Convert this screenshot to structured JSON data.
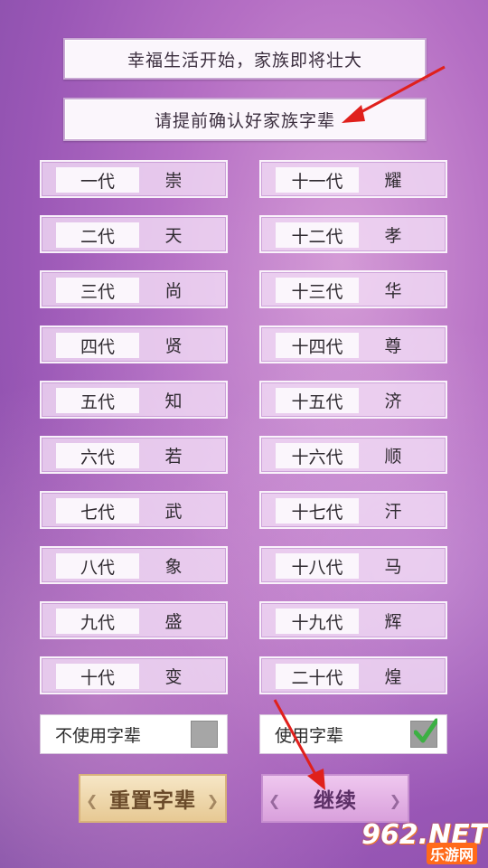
{
  "banner_top": "幸福生活开始，家族即将壮大",
  "banner_confirm": "请提前确认好家族字辈",
  "generations": [
    {
      "label": "一代",
      "char": "崇"
    },
    {
      "label": "二代",
      "char": "天"
    },
    {
      "label": "三代",
      "char": "尚"
    },
    {
      "label": "四代",
      "char": "贤"
    },
    {
      "label": "五代",
      "char": "知"
    },
    {
      "label": "六代",
      "char": "若"
    },
    {
      "label": "七代",
      "char": "武"
    },
    {
      "label": "八代",
      "char": "象"
    },
    {
      "label": "九代",
      "char": "盛"
    },
    {
      "label": "十代",
      "char": "变"
    },
    {
      "label": "十一代",
      "char": "耀"
    },
    {
      "label": "十二代",
      "char": "孝"
    },
    {
      "label": "十三代",
      "char": "华"
    },
    {
      "label": "十四代",
      "char": "尊"
    },
    {
      "label": "十五代",
      "char": "济"
    },
    {
      "label": "十六代",
      "char": "顺"
    },
    {
      "label": "十七代",
      "char": "汗"
    },
    {
      "label": "十八代",
      "char": "马"
    },
    {
      "label": "十九代",
      "char": "辉"
    },
    {
      "label": "二十代",
      "char": "煌"
    }
  ],
  "options": {
    "no_use": {
      "label": "不使用字辈",
      "checked": false
    },
    "use": {
      "label": "使用字辈",
      "checked": true
    }
  },
  "buttons": {
    "reset": "重置字辈",
    "continue": "继续"
  },
  "watermark": {
    "brand": "962.NET",
    "sub": "乐游网"
  },
  "colors": {
    "accent_check": "#3cb043",
    "arrow": "#e0201c"
  }
}
